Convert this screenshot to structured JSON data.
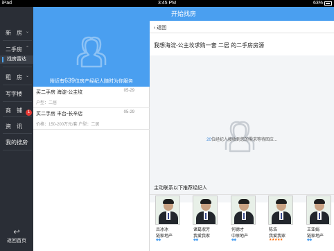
{
  "status_bar": {
    "carrier": "iPad",
    "time": "3:45 PM",
    "battery": "63%"
  },
  "header": {
    "title": "开始找房"
  },
  "sidebar": {
    "items": [
      {
        "label": "新　房",
        "chevron": "⌄"
      },
      {
        "label": "二手房",
        "chevron": "⌃"
      },
      {
        "label": "租　房",
        "chevron": "⌄"
      },
      {
        "label": "写字楼",
        "chevron": ""
      },
      {
        "label": "商　铺",
        "chevron": ""
      },
      {
        "label": "资　讯",
        "chevron": ""
      },
      {
        "label": "我的搜房",
        "chevron": "⌄"
      }
    ],
    "sub_item": {
      "label": "找房雷达"
    },
    "badge": "1",
    "back_home": {
      "icon": "↩",
      "label": "返回首页"
    }
  },
  "banner": {
    "text_before": "附近有",
    "count": "639",
    "text_after": "位房产经纪人随时为你服务"
  },
  "requests": [
    {
      "title": "买二手房  海淀-公主坟",
      "date": "05-29",
      "detail": "户型：二居"
    },
    {
      "title": "买二手房  丰台-长辛店",
      "date": "05-29",
      "detail": "价格：150-200万元/套  户型：二居"
    }
  ],
  "detail_panel": {
    "back_label": "返回",
    "request_title": "我想海淀-公主坟求购一套 二居 的二手房房源",
    "waiting_count": "20",
    "waiting_text": "位经纪人接收到您的需求等待回应...",
    "recommend_title": "主动联系以下推荐经纪人"
  },
  "agents": [
    {
      "name": "吕冰冰",
      "company": "链家地产",
      "rating": "◆◆",
      "stars": false
    },
    {
      "name": "诸葛淑芳",
      "company": "我爱我家",
      "rating": "◆◆",
      "stars": false
    },
    {
      "name": "何德才",
      "company": "中原地产",
      "rating": "◆◆",
      "stars": false
    },
    {
      "name": "陈浩",
      "company": "我爱我家",
      "rating": "★★★★★",
      "stars": true
    },
    {
      "name": "王亚娟",
      "company": "链家地产",
      "rating": "◆◆",
      "stars": false
    }
  ],
  "colors": {
    "accent": "#4a9ff0",
    "sidebar_bg": "#2a2e36",
    "badge": "#e53935",
    "stars": "#ff6a00"
  }
}
